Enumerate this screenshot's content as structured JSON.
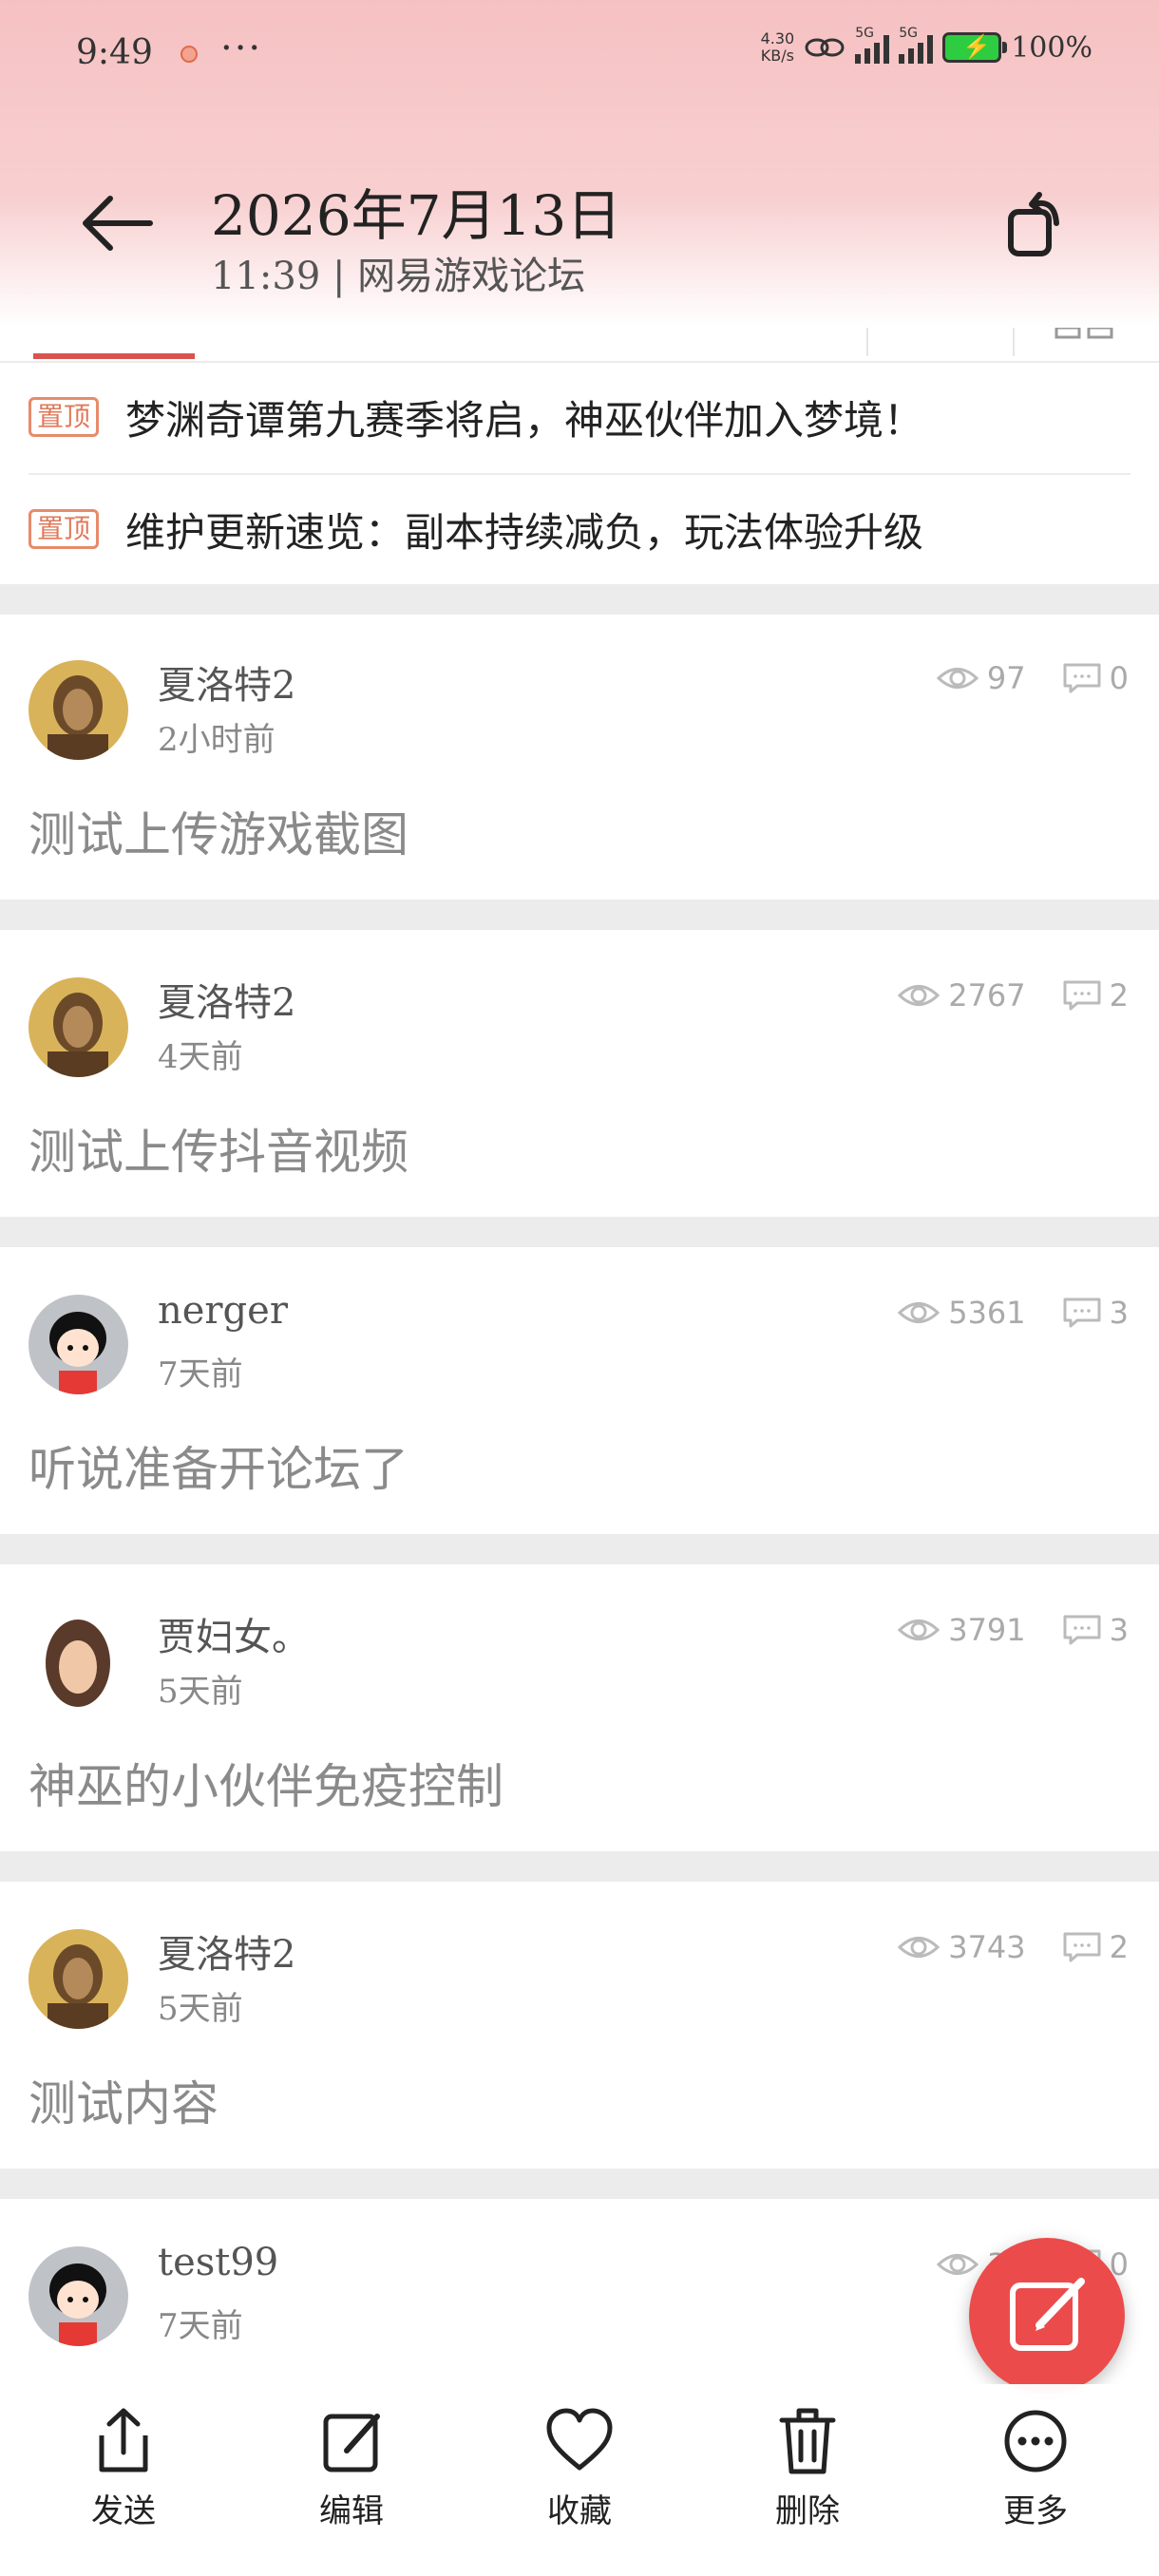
{
  "status_bar": {
    "time": "9:49",
    "dots": "···",
    "net_speed_value": "4.30",
    "net_speed_unit": "KB/s",
    "sig1_label": "5G",
    "sig2_label": "5G",
    "battery": "100%"
  },
  "header": {
    "title": "2026年7月13日",
    "subtitle": "11:39 | 网易游戏论坛"
  },
  "pinned": [
    {
      "badge": "置顶",
      "text": "梦渊奇谭第九赛季将启，神巫伙伴加入梦境！"
    },
    {
      "badge": "置顶",
      "text": "维护更新速览：副本持续减负，玩法体验升级"
    }
  ],
  "posts": [
    {
      "author": "夏洛特2",
      "time": "2小时前",
      "title": "测试上传游戏截图",
      "views": "97",
      "comments": "0",
      "avatar": "portrait-a"
    },
    {
      "author": "夏洛特2",
      "time": "4天前",
      "title": "测试上传抖音视频",
      "views": "2767",
      "comments": "2",
      "avatar": "portrait-a"
    },
    {
      "author": "nerger",
      "time": "7天前",
      "title": "听说准备开论坛了",
      "views": "5361",
      "comments": "3",
      "avatar": "cartoon"
    },
    {
      "author": "贾妇女。",
      "time": "5天前",
      "title": "神巫的小伙伴免疫控制",
      "views": "3791",
      "comments": "3",
      "avatar": "portrait-b"
    },
    {
      "author": "夏洛特2",
      "time": "5天前",
      "title": "测试内容",
      "views": "3743",
      "comments": "2",
      "avatar": "portrait-a"
    },
    {
      "author": "test99",
      "time": "7天前",
      "title": "",
      "views": "35",
      "comments": "0",
      "avatar": "cartoon"
    }
  ],
  "bottom_bar": {
    "send": "发送",
    "edit": "编辑",
    "favorite": "收藏",
    "delete": "删除",
    "more": "更多"
  },
  "colors": {
    "accent": "#ec4b4b",
    "header_pink": "#f6c1c2",
    "pin_badge": "#e07a5a"
  }
}
